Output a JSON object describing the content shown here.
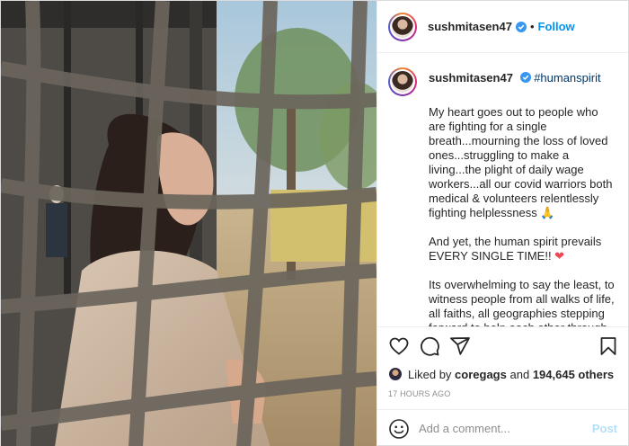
{
  "header": {
    "username": "sushmitasen47",
    "separator": "•",
    "follow_label": "Follow"
  },
  "caption": {
    "username": "sushmitasen47",
    "hashtag": "#humanspirit",
    "paragraphs": [
      "My heart goes out to people who are fighting for a single breath...mourning the loss of loved ones...struggling to make a living...the plight of daily wage workers...all our covid warriors both medical & volunteers relentlessly fighting helplessness 🙏",
      "And yet, the human spirit prevails EVERY SINGLE TIME!! ",
      "Its overwhelming to say the least, to witness people from all walks of life, all faiths, all geographies stepping forward to help each other through this pandemic UNCONDITIONALLY...driven purely by"
    ],
    "heart": "❤"
  },
  "actions": {
    "icons": [
      "heart-icon",
      "comment-icon",
      "share-icon",
      "bookmark-icon"
    ]
  },
  "likes": {
    "prefix": "Liked by",
    "liker": "coregags",
    "conjunction": "and",
    "count": "194,645 others"
  },
  "timestamp": "17 HOURS AGO",
  "comment_box": {
    "placeholder": "Add a comment...",
    "post_label": "Post"
  },
  "colors": {
    "follow_blue": "#0095f6",
    "verified_blue": "#3897f0",
    "hashtag": "#00376b",
    "heart_red": "#ed4956",
    "post_disabled": "#b2dffc"
  }
}
